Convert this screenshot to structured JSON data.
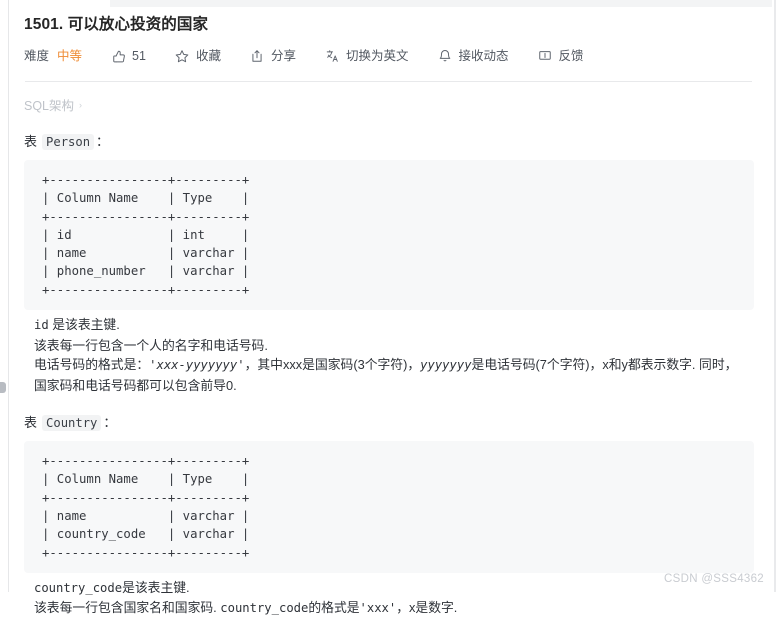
{
  "header": {
    "title": "1501. 可以放心投资的国家",
    "toolbar": {
      "difficulty_label": "难度",
      "difficulty_value": "中等",
      "likes_count": "51",
      "favorite_label": "收藏",
      "share_label": "分享",
      "translate_label": "切换为英文",
      "subscribe_label": "接收动态",
      "feedback_label": "反馈"
    },
    "icons": {
      "thumbs_up": "thumbs-up-icon",
      "star": "star-icon",
      "share": "share-icon",
      "translate": "translate-icon",
      "bell": "bell-icon",
      "feedback": "feedback-icon"
    }
  },
  "breadcrumb": {
    "label": "SQL架构",
    "chevron": "›"
  },
  "sections": [
    {
      "prefix": "表",
      "table_name": "Person",
      "colon": "：",
      "code": "+----------------+---------+\n| Column Name    | Type    |\n+----------------+---------+\n| id             | int     |\n| name           | varchar |\n| phone_number   | varchar |\n+----------------+---------+",
      "notes": [
        {
          "parts": [
            {
              "text": "id",
              "style": "mono"
            },
            {
              "text": " 是该表主键.",
              "style": "plain"
            }
          ]
        },
        {
          "parts": [
            {
              "text": "该表每一行包含一个人的名字和电话号码.",
              "style": "plain"
            }
          ]
        },
        {
          "parts": [
            {
              "text": "电话号码的格式是：",
              "style": "plain"
            },
            {
              "text": "'xxx-yyyyyyy'",
              "style": "mono-i"
            },
            {
              "text": "，其中xxx是国家码(3个字符)，",
              "style": "plain"
            },
            {
              "text": "yyyyyyy",
              "style": "mono-i"
            },
            {
              "text": "是电话号码(7个字符)，x和y都表示数字. 同时，国家码和电话号码都可以包含前导0.",
              "style": "plain"
            }
          ]
        }
      ]
    },
    {
      "prefix": "表",
      "table_name": "Country",
      "colon": "：",
      "code": "+----------------+---------+\n| Column Name    | Type    |\n+----------------+---------+\n| name           | varchar |\n| country_code   | varchar |\n+----------------+---------+",
      "notes": [
        {
          "parts": [
            {
              "text": "country_code",
              "style": "mono"
            },
            {
              "text": "是该表主键.",
              "style": "plain"
            }
          ]
        },
        {
          "parts": [
            {
              "text": "该表每一行包含国家名和国家码. ",
              "style": "plain"
            },
            {
              "text": "country_code",
              "style": "mono"
            },
            {
              "text": "的格式是",
              "style": "plain"
            },
            {
              "text": "'xxx'",
              "style": "mono"
            },
            {
              "text": "，x是数字.",
              "style": "plain"
            }
          ]
        }
      ]
    }
  ],
  "watermark": "CSDN @SSS4362",
  "colors": {
    "accent_orange": "#ef8c35",
    "code_bg": "#f7f8f9",
    "text": "#2e3238",
    "muted": "#bfc3c9"
  }
}
